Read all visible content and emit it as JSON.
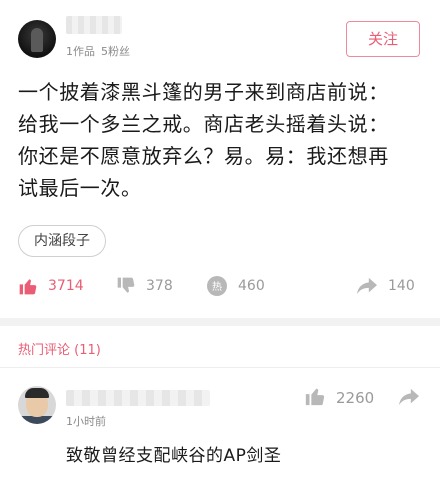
{
  "author": {
    "works": "1作品",
    "fans": "5粉丝",
    "follow_label": "关注"
  },
  "post": {
    "lines": [
      "一个披着漆黑斗篷的男子来到商店前说：",
      "给我一个多兰之戒。商店老头摇着头说：",
      "你还是不愿意放弃么？易。易：我还想再",
      "试最后一次。"
    ],
    "tag": "内涵段子"
  },
  "actions": {
    "likes": "3714",
    "dislikes": "378",
    "comments": "460",
    "comment_badge": "热",
    "shares": "140"
  },
  "hot_comments": {
    "title": "热门评论 (11)",
    "items": [
      {
        "time": "1小时前",
        "likes": "2260",
        "text": "致敬曾经支配峡谷的AP剑圣"
      }
    ]
  },
  "colors": {
    "accent": "#ea5d74",
    "muted": "#9a9a9a",
    "divider": "#f2f2f2"
  },
  "icons": [
    "thumbs-up-icon",
    "thumbs-down-icon",
    "hot-comment-icon",
    "share-icon"
  ]
}
